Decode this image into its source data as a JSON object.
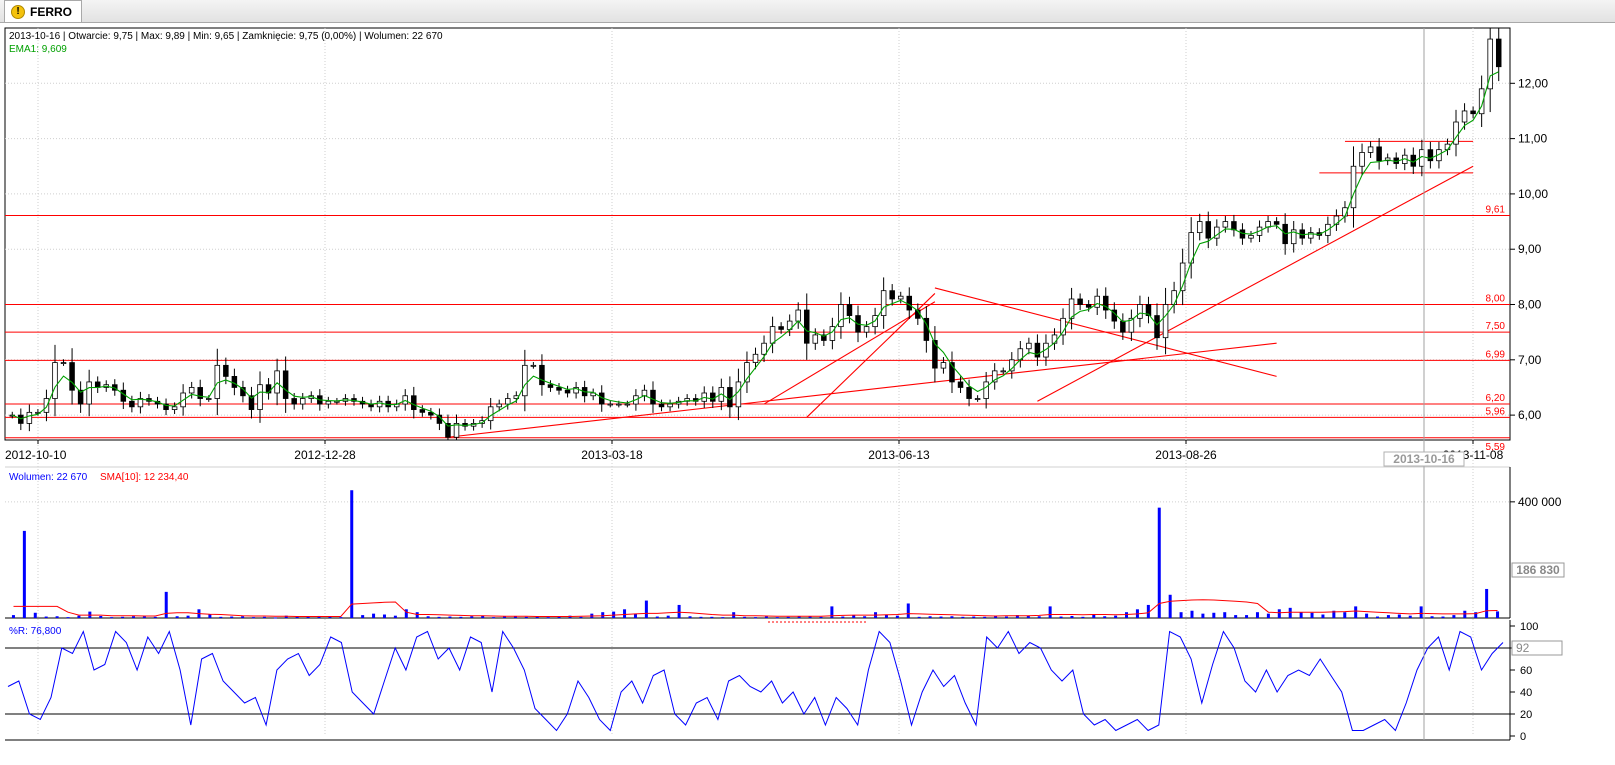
{
  "tab": {
    "icon": "warning-icon",
    "label": "FERRO"
  },
  "info": {
    "ohlc": "2013-10-16 | Otwarcie: 9,75 | Max: 9,89 | Min: 9,65 | Zamknięcie: 9,75 (0,00%)  | Wolumen: 22 670",
    "ema": "EMA1: 9,609",
    "volume_legend": "Wolumen: 22 670",
    "sma_legend": "SMA[10]: 12 234,40",
    "wr_legend": "%R: 76,800"
  },
  "colors": {
    "candle": "#000000",
    "ema": "#00a000",
    "lines": "#ff0000",
    "volume": "#0000ff",
    "wr": "#0000ff",
    "sma": "#ff0000"
  },
  "cursor": {
    "date": "2013-10-16",
    "volume": "186 830",
    "wr": "92"
  },
  "chart_data": [
    {
      "type": "candlestick",
      "x_ticks": [
        "2012-10-10",
        "2012-12-28",
        "2013-03-18",
        "2013-06-13",
        "2013-08-26",
        "2013-11-08"
      ],
      "y_ticks": [
        "6,00",
        "7,00",
        "8,00",
        "9,00",
        "10,00",
        "11,00",
        "12,00"
      ],
      "ylim": [
        5.55,
        13.0
      ],
      "level_labels": [
        "9,61",
        "8,00",
        "7,50",
        "6,99",
        "6,20",
        "5,96",
        "5,59"
      ],
      "levels": [
        9.61,
        8.0,
        7.5,
        6.99,
        6.2,
        5.96,
        5.59
      ],
      "close": [
        6.0,
        5.85,
        6.05,
        6.05,
        6.3,
        6.95,
        6.95,
        6.45,
        6.2,
        6.6,
        6.5,
        6.55,
        6.45,
        6.25,
        6.15,
        6.3,
        6.25,
        6.2,
        6.1,
        6.15,
        6.4,
        6.5,
        6.3,
        6.3,
        6.9,
        6.7,
        6.5,
        6.35,
        6.1,
        6.55,
        6.4,
        6.8,
        6.3,
        6.2,
        6.3,
        6.35,
        6.2,
        6.25,
        6.25,
        6.3,
        6.25,
        6.2,
        6.15,
        6.25,
        6.15,
        6.2,
        6.35,
        6.1,
        6.05,
        6.0,
        5.85,
        5.6,
        5.85,
        5.8,
        5.85,
        5.9,
        6.15,
        6.2,
        6.3,
        6.35,
        6.9,
        6.9,
        6.55,
        6.5,
        6.45,
        6.4,
        6.5,
        6.35,
        6.4,
        6.2,
        6.2,
        6.2,
        6.2,
        6.35,
        6.45,
        6.2,
        6.15,
        6.2,
        6.25,
        6.3,
        6.25,
        6.4,
        6.25,
        6.5,
        6.15,
        6.6,
        6.95,
        7.1,
        7.3,
        7.6,
        7.55,
        7.7,
        7.9,
        7.3,
        7.45,
        7.35,
        7.6,
        8.0,
        7.8,
        7.5,
        7.6,
        7.8,
        8.25,
        8.1,
        8.15,
        7.9,
        7.75,
        7.35,
        6.85,
        6.95,
        6.6,
        6.5,
        6.3,
        6.3,
        6.6,
        6.8,
        6.8,
        7.0,
        7.2,
        7.3,
        7.05,
        7.3,
        7.45,
        7.75,
        8.1,
        8.0,
        7.95,
        8.15,
        7.9,
        7.7,
        7.5,
        7.75,
        8.0,
        7.8,
        7.4,
        8.0,
        8.25,
        8.75,
        9.3,
        9.5,
        9.2,
        9.4,
        9.5,
        9.35,
        9.2,
        9.25,
        9.4,
        9.5,
        9.45,
        9.1,
        9.35,
        9.2,
        9.3,
        9.25,
        9.45,
        9.6,
        9.75,
        10.5,
        10.75,
        10.85,
        10.6,
        10.65,
        10.55,
        10.7,
        10.5,
        10.8,
        10.6,
        10.8,
        10.9,
        11.3,
        11.5,
        11.45,
        11.9,
        12.8,
        12.3
      ]
    },
    {
      "type": "bar",
      "series_name": "Wolumen",
      "y_ticks": [
        "400 000"
      ],
      "ylim": [
        0,
        520000
      ],
      "values": [
        10000,
        300000,
        18000,
        5000,
        6000,
        3000,
        8000,
        22000,
        7000,
        3000,
        4000,
        6000,
        5000,
        4000,
        90000,
        6000,
        8000,
        30000,
        12000,
        4000,
        5000,
        6000,
        3000,
        4000,
        2000,
        8000,
        4000,
        4000,
        7000,
        5000,
        3000,
        440000,
        10000,
        15000,
        12000,
        8000,
        30000,
        20000,
        6000,
        4000,
        5000,
        4000,
        6000,
        8000,
        3000,
        5000,
        6000,
        4000,
        4000,
        3000,
        5000,
        8000,
        4000,
        15000,
        20000,
        22000,
        30000,
        14000,
        60000,
        5000,
        8000,
        45000,
        6000,
        4000,
        4000,
        3000,
        20000,
        4000,
        3000,
        5000,
        3000,
        4000,
        6000,
        5000,
        4000,
        40000,
        5000,
        10000,
        6000,
        20000,
        12000,
        8000,
        50000,
        4000,
        6000,
        5000,
        6000,
        4000,
        5000,
        4000,
        8000,
        5000,
        10000,
        8000,
        6000,
        40000,
        5000,
        7000,
        4000,
        12000,
        6000,
        8000,
        20000,
        30000,
        45000,
        380000,
        80000,
        20000,
        25000,
        15000,
        18000,
        20000,
        10000,
        10000,
        20000,
        15000,
        30000,
        35000,
        20000,
        18000,
        12000,
        25000,
        20000,
        40000,
        15000,
        5000,
        10000,
        12000,
        8000,
        40000,
        6000,
        5000,
        10000,
        25000,
        20000,
        100000,
        22670
      ],
      "sma": [
        40000,
        40000,
        40000,
        40000,
        40000,
        20000,
        10000,
        10000,
        10000,
        8000,
        8000,
        8000,
        7000,
        7000,
        16000,
        18000,
        18000,
        15000,
        13000,
        12000,
        10000,
        8000,
        7000,
        7000,
        6000,
        6000,
        5000,
        5000,
        5000,
        5000,
        5000,
        48000,
        50000,
        52000,
        54000,
        55000,
        20000,
        12000,
        12000,
        11000,
        10000,
        9000,
        8000,
        8000,
        7000,
        6000,
        6000,
        6000,
        5000,
        5000,
        5000,
        5000,
        6000,
        7000,
        8000,
        10000,
        12000,
        14000,
        16000,
        16000,
        18000,
        20000,
        18000,
        15000,
        12000,
        10000,
        10000,
        8000,
        8000,
        7000,
        6000,
        6000,
        6000,
        6000,
        6000,
        8000,
        9000,
        10000,
        10000,
        10000,
        11000,
        12000,
        15000,
        14000,
        13000,
        12000,
        11000,
        10000,
        9000,
        8000,
        7000,
        8000,
        8000,
        8000,
        9000,
        12000,
        12000,
        12000,
        11000,
        12000,
        12000,
        11000,
        12000,
        14000,
        18000,
        50000,
        58000,
        60000,
        62000,
        63000,
        62000,
        60000,
        58000,
        55000,
        50000,
        20000,
        18000,
        20000,
        20000,
        20000,
        20000,
        21000,
        22000,
        24000,
        22000,
        20000,
        18000,
        16000,
        14000,
        16000,
        15000,
        14000,
        14000,
        14000,
        15000,
        25000,
        26000
      ]
    },
    {
      "type": "line",
      "series_name": "%R",
      "y_ticks": [
        "0",
        "20",
        "40",
        "60",
        "80",
        "100"
      ],
      "ylim": [
        0,
        100
      ],
      "values": [
        45,
        50,
        20,
        15,
        35,
        80,
        75,
        95,
        60,
        65,
        95,
        85,
        60,
        90,
        75,
        95,
        60,
        10,
        70,
        75,
        50,
        40,
        30,
        35,
        10,
        60,
        70,
        75,
        55,
        65,
        90,
        85,
        40,
        30,
        20,
        50,
        80,
        60,
        90,
        95,
        70,
        80,
        60,
        90,
        85,
        40,
        95,
        80,
        60,
        25,
        15,
        5,
        20,
        50,
        35,
        15,
        5,
        40,
        50,
        30,
        55,
        60,
        20,
        10,
        30,
        35,
        15,
        50,
        55,
        45,
        40,
        50,
        30,
        40,
        20,
        35,
        10,
        35,
        25,
        10,
        60,
        95,
        85,
        50,
        10,
        40,
        60,
        45,
        55,
        30,
        10,
        90,
        80,
        95,
        75,
        85,
        80,
        60,
        50,
        60,
        20,
        10,
        15,
        5,
        10,
        15,
        5,
        10,
        95,
        90,
        70,
        30,
        65,
        95,
        80,
        50,
        40,
        60,
        40,
        55,
        60,
        55,
        70,
        55,
        40,
        5,
        5,
        10,
        15,
        5,
        30,
        60,
        80,
        90,
        60,
        95,
        90,
        60,
        75,
        85
      ],
      "overbought": 80,
      "oversold": 20
    }
  ]
}
